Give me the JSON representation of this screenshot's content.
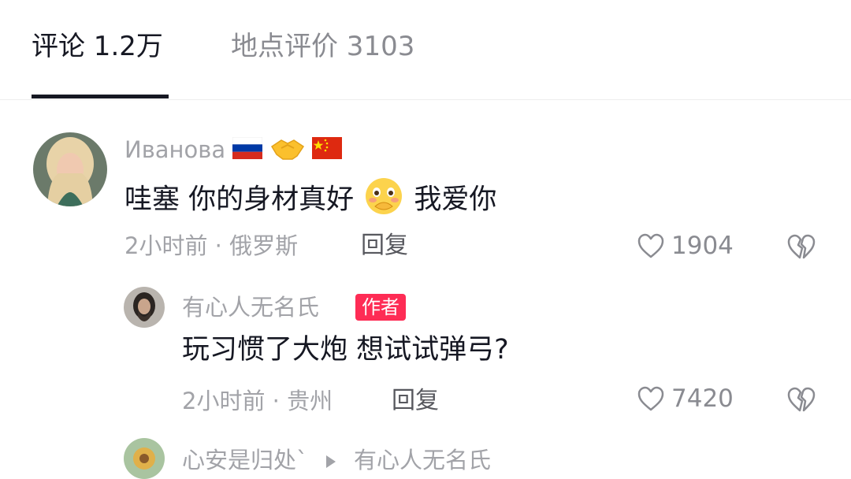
{
  "tabs": [
    {
      "label": "评论 1.2万"
    },
    {
      "label": "地点评价 3103"
    }
  ],
  "comments": [
    {
      "username": "Иванова",
      "username_icons": [
        "russia-flag-icon",
        "handshake-icon",
        "china-flag-icon"
      ],
      "text_before": "哇塞 你的身材真好",
      "text_emoji": "shy-face-icon",
      "text_after": "我爱你",
      "meta": "2小时前 · 俄罗斯",
      "reply_label": "回复",
      "likes": "1904"
    }
  ],
  "replies": [
    {
      "username": "有心人无名氏",
      "badge": "作者",
      "text": "玩习惯了大炮 想试试弹弓?",
      "meta": "2小时前 · 贵州",
      "reply_label": "回复",
      "likes": "7420"
    },
    {
      "username": "心安是归处`",
      "reply_to": "有心人无名氏"
    }
  ],
  "colors": {
    "accent": "#fe2c55",
    "text_primary": "#161823",
    "text_secondary": "#a2a3a8"
  }
}
